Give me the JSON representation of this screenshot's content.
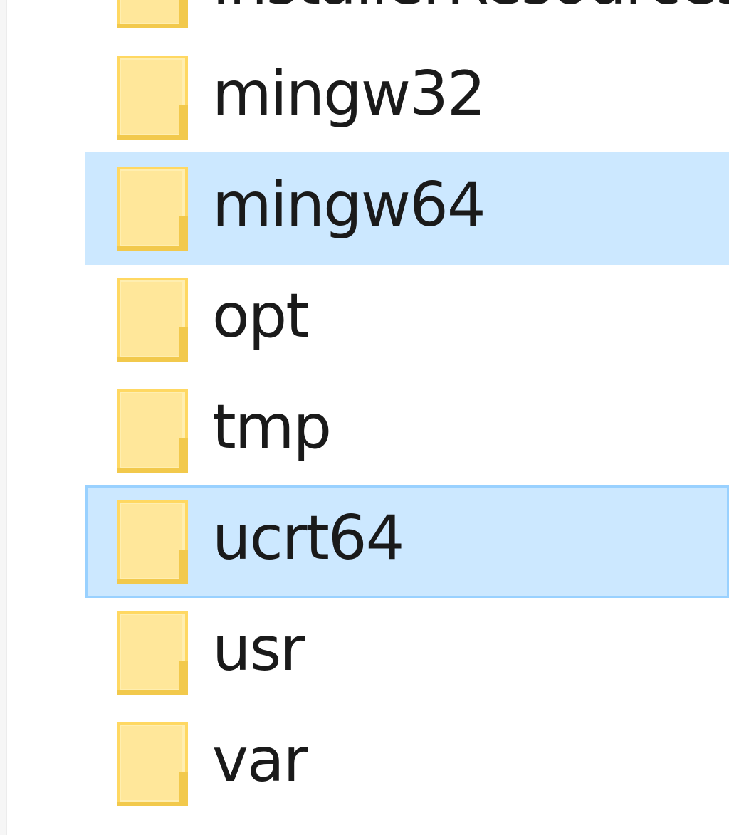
{
  "explorer": {
    "colors": {
      "hover_background": "#cce8ff",
      "selected_background": "#cce8ff",
      "selected_border": "#99d1ff",
      "folder_yellow": "#ffd862",
      "folder_light": "#ffeeb0"
    },
    "items": [
      {
        "label": "InstallerResources",
        "icon": "folder-icon",
        "state": "normal"
      },
      {
        "label": "mingw32",
        "icon": "folder-icon",
        "state": "normal"
      },
      {
        "label": "mingw64",
        "icon": "folder-icon",
        "state": "hover"
      },
      {
        "label": "opt",
        "icon": "folder-icon",
        "state": "normal"
      },
      {
        "label": "tmp",
        "icon": "folder-icon",
        "state": "normal"
      },
      {
        "label": "ucrt64",
        "icon": "folder-icon",
        "state": "selected"
      },
      {
        "label": "usr",
        "icon": "folder-icon",
        "state": "normal"
      },
      {
        "label": "var",
        "icon": "folder-icon",
        "state": "normal"
      }
    ]
  }
}
